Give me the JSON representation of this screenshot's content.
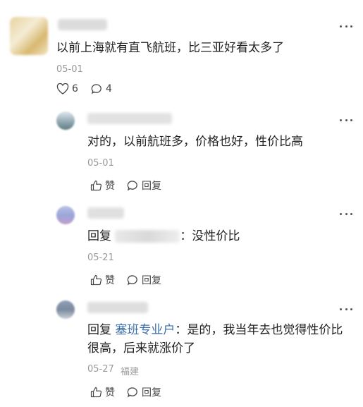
{
  "comments": [
    {
      "text": "以前上海就有直飞航班，比三亚好看太多了",
      "date": "05-01",
      "likes": "6",
      "replies": "4"
    }
  ],
  "replies": [
    {
      "text": "对的，以前航班多，价格也好，性价比高",
      "date": "05-01",
      "like_label": "赞",
      "reply_label": "回复"
    },
    {
      "prefix": "回复",
      "suffix": "：没性价比",
      "date": "05-21",
      "like_label": "赞",
      "reply_label": "回复"
    },
    {
      "prefix": "回复",
      "target": "塞班专业户",
      "line1": "：是的，我当年去也觉得性价比",
      "line2": "很高，后来就涨价了",
      "date": "05-27",
      "location": "福建",
      "like_label": "赞",
      "reply_label": "回复"
    }
  ],
  "colors": {
    "link": "#3b6ea8",
    "text": "#222222",
    "meta": "#999999"
  }
}
